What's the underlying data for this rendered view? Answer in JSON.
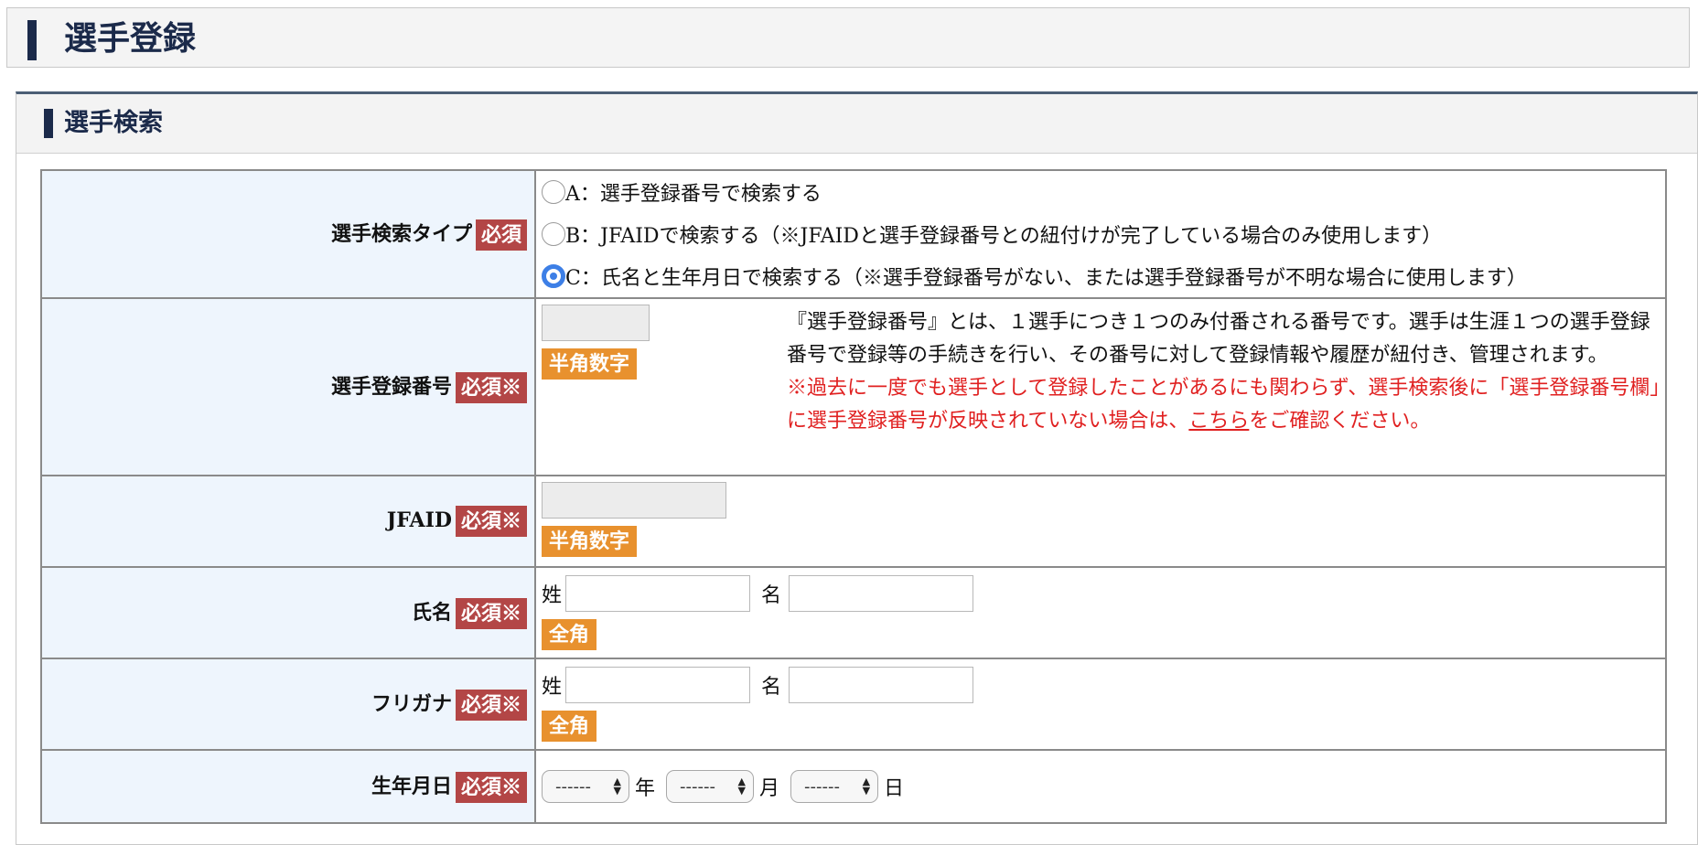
{
  "page_title": "選手登録",
  "section_title": "選手検索",
  "rows": {
    "search_type": {
      "label": "選手検索タイプ",
      "req": "必須",
      "options": [
        {
          "text": "A：選手登録番号で検索する",
          "selected": false
        },
        {
          "text": "B：JFAIDで検索する（※JFAIDと選手登録番号との紐付けが完了している場合のみ使用します）",
          "selected": false
        },
        {
          "text": "C：氏名と生年月日で検索する（※選手登録番号がない、または選手登録番号が不明な場合に使用します）",
          "selected": true
        }
      ]
    },
    "reg_no": {
      "label": "選手登録番号",
      "req": "必須※",
      "value": "",
      "tag": "半角数字",
      "note": "『選手登録番号』とは、１選手につき１つのみ付番される番号です。選手は生涯１つの選手登録番号で登録等の手続きを行い、その番号に対して登録情報や履歴が紐付き、管理されます。",
      "warn_before": "※過去に一度でも選手として登録したことがあるにも関わらず、選手検索後に「選手登録番号欄」に選手登録番号が反映されていない場合は、",
      "warn_link": "こちら",
      "warn_after": "をご確認ください。"
    },
    "jfaid": {
      "label": "JFAID",
      "req": "必須※",
      "value": "",
      "tag": "半角数字"
    },
    "name": {
      "label": "氏名",
      "req": "必須※",
      "sei": "姓",
      "mei": "名",
      "sei_value": "",
      "mei_value": "",
      "tag": "全角"
    },
    "kana": {
      "label": "フリガナ",
      "req": "必須※",
      "sei": "姓",
      "mei": "名",
      "sei_value": "",
      "mei_value": "",
      "tag": "全角"
    },
    "birth": {
      "label": "生年月日",
      "req": "必須※",
      "year_value": "------",
      "month_value": "------",
      "day_value": "------",
      "year_unit": "年",
      "month_unit": "月",
      "day_unit": "日"
    }
  }
}
